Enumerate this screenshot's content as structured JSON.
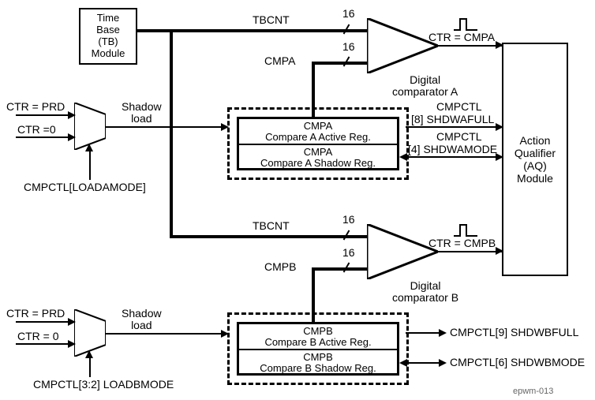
{
  "blocks": {
    "time_base": {
      "line1": "Time",
      "line2": "Base",
      "line3": "(TB)",
      "line4": "Module"
    },
    "action_qualifier": {
      "line1": "Action",
      "line2": "Qualifier",
      "line3": "(AQ)",
      "line4": "Module"
    }
  },
  "signals": {
    "tbcnt_a": "TBCNT",
    "tbcnt_a_width": "16",
    "cmpa": "CMPA",
    "cmpa_width": "16",
    "tbcnt_b": "TBCNT",
    "tbcnt_b_width": "16",
    "cmpb": "CMPB",
    "cmpb_width": "16"
  },
  "mux_a": {
    "in0": "CTR = PRD",
    "in1": "CTR =0",
    "out": "Shadow\nload",
    "sel": "CMPCTL[LOADAMODE]"
  },
  "mux_b": {
    "in0": "CTR = PRD",
    "in1": "CTR = 0",
    "out": "Shadow\nload",
    "sel": "CMPCTL[3:2] LOADBMODE"
  },
  "regs_a": {
    "active_name": "CMPA",
    "active_desc": "Compare A Active Reg.",
    "shadow_name": "CMPA",
    "shadow_desc": "Compare A Shadow Reg."
  },
  "regs_b": {
    "active_name": "CMPB",
    "active_desc": "Compare B Active Reg.",
    "shadow_name": "CMPB",
    "shadow_desc": "Compare B Shadow Reg."
  },
  "comp_a": {
    "out": "CTR = CMPA",
    "desc": "Digital\ncomparator A"
  },
  "comp_b": {
    "out": "CTR = CMPB",
    "desc": "Digital\ncomparator B"
  },
  "status_a": {
    "full_reg": "CMPCTL",
    "full_bit": "[8] SHDWAFULL",
    "mode_reg": "CMPCTL",
    "mode_bit": "[4] SHDWAMODE"
  },
  "status_b": {
    "full": "CMPCTL[9] SHDWBFULL",
    "mode": "CMPCTL[6] SHDWBMODE"
  },
  "figure_id": "epwm-013"
}
